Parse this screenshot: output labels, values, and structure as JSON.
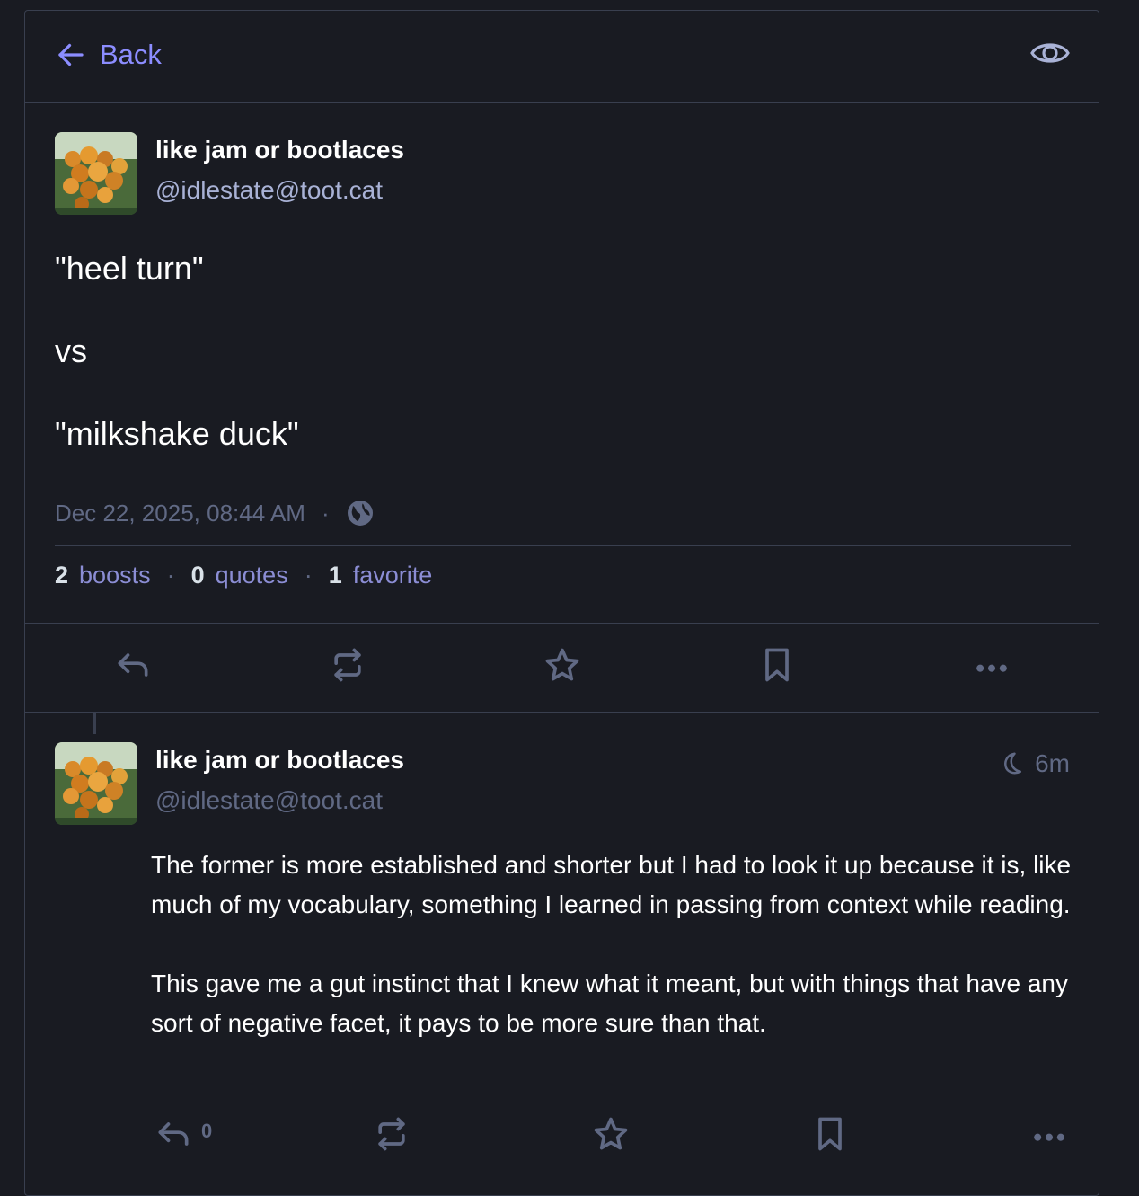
{
  "header": {
    "back_label": "Back",
    "back_icon": "arrow-left-icon",
    "visibility_icon": "eye-icon"
  },
  "main_status": {
    "display_name": "like jam or bootlaces",
    "account": "@idlestate@toot.cat",
    "content": [
      "\"heel turn\"",
      "vs",
      "\"milkshake duck\""
    ],
    "timestamp": "Dec 22, 2025, 08:44 AM",
    "separator": "·",
    "visibility": "globe-icon",
    "stats": {
      "boosts_count": "2",
      "boosts_label": "boosts",
      "quotes_count": "0",
      "quotes_label": "quotes",
      "favorites_count": "1",
      "favorites_label": "favorite"
    },
    "actions": [
      "reply-icon",
      "boost-icon",
      "star-icon",
      "bookmark-icon",
      "more-icon"
    ]
  },
  "reply_status": {
    "display_name": "like jam or bootlaces",
    "account": "@idlestate@toot.cat",
    "visibility_icon": "moon-icon",
    "relative_time": "6m",
    "paragraphs": [
      "The former is more established and shorter but I had to look it up because it is, like much of my vocabulary, something I learned in passing from context while reading.",
      "This gave me a gut instinct that I knew what it meant, but with things that have any sort of negative  facet, it pays to be more sure than that."
    ],
    "reply_count": "0",
    "actions": [
      "reply-icon",
      "boost-icon",
      "star-icon",
      "bookmark-icon",
      "more-icon"
    ]
  },
  "colors": {
    "background": "#191b22",
    "accent": "#8c8dff",
    "muted": "#606984",
    "border": "#393f4f"
  }
}
